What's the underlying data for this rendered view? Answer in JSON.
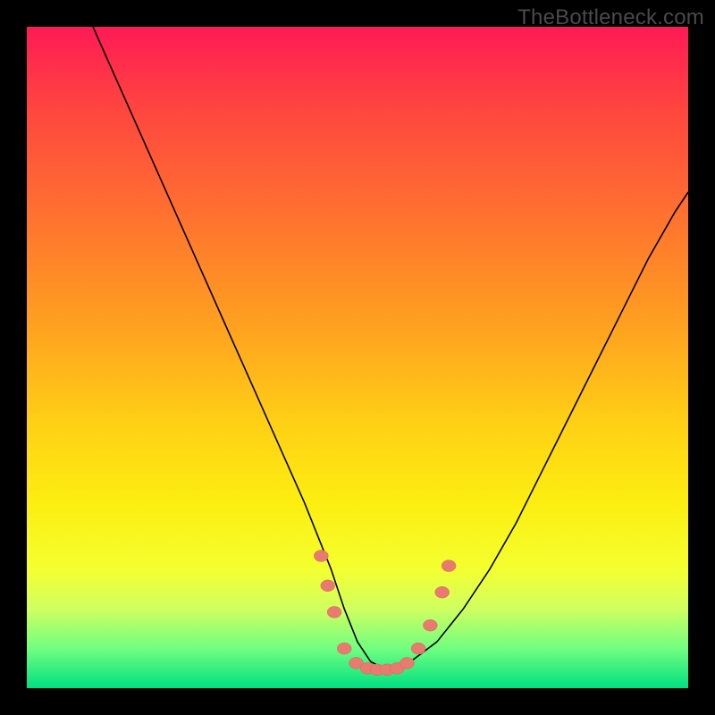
{
  "watermark": "TheBottleneck.com",
  "chart_data": {
    "type": "line",
    "title": "",
    "xlabel": "",
    "ylabel": "",
    "xlim": [
      0,
      100
    ],
    "ylim": [
      0,
      100
    ],
    "grid": false,
    "legend": false,
    "comment": "Bottleneck curve. x approximates hardware ratio; y approximates bottleneck percentage. Values estimated from pixel positions since axes are unlabeled.",
    "series": [
      {
        "name": "bottleneck-curve",
        "x": [
          10,
          14,
          18,
          22,
          26,
          30,
          34,
          38,
          42,
          46,
          48,
          50,
          52,
          54,
          56,
          58,
          62,
          66,
          70,
          74,
          78,
          82,
          86,
          90,
          94,
          98,
          100
        ],
        "y": [
          100,
          91,
          82,
          73,
          64,
          55,
          46,
          37,
          28,
          18,
          12,
          7,
          4,
          3,
          3,
          4,
          7,
          12,
          18,
          25,
          33,
          41,
          49,
          57,
          65,
          72,
          75
        ]
      }
    ],
    "markers": {
      "comment": "Salmon dot markers clustered near the curve bottom",
      "points": [
        {
          "x": 44.5,
          "y": 20.0
        },
        {
          "x": 45.5,
          "y": 15.5
        },
        {
          "x": 46.5,
          "y": 11.5
        },
        {
          "x": 48.0,
          "y": 6.0
        },
        {
          "x": 49.8,
          "y": 3.8
        },
        {
          "x": 51.5,
          "y": 3.0
        },
        {
          "x": 53.0,
          "y": 2.8
        },
        {
          "x": 54.5,
          "y": 2.8
        },
        {
          "x": 56.0,
          "y": 3.0
        },
        {
          "x": 57.5,
          "y": 3.8
        },
        {
          "x": 59.2,
          "y": 6.0
        },
        {
          "x": 61.0,
          "y": 9.5
        },
        {
          "x": 62.8,
          "y": 14.5
        },
        {
          "x": 63.8,
          "y": 18.5
        }
      ]
    }
  }
}
